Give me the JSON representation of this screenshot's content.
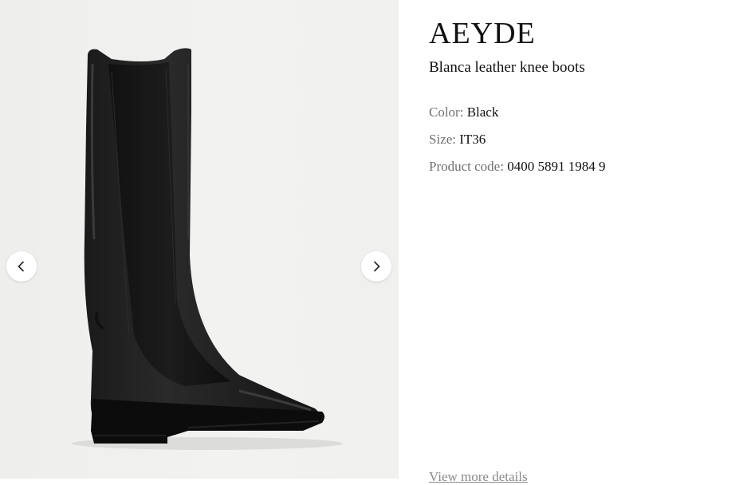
{
  "gallery": {
    "image_alt": "Blanca leather knee boots",
    "prev_icon": "chevron-left-icon",
    "next_icon": "chevron-right-icon"
  },
  "product": {
    "brand": "AEYDE",
    "name": "Blanca leather knee boots",
    "color_label": "Color:",
    "color_value": "Black",
    "size_label": "Size:",
    "size_value": "IT36",
    "code_label": "Product code:",
    "code_value": "0400 5891 1984 9",
    "more_details_label": "View more details"
  },
  "colors": {
    "label_gray": "#707070",
    "text": "#111111",
    "gallery_bg": "#efefed"
  }
}
